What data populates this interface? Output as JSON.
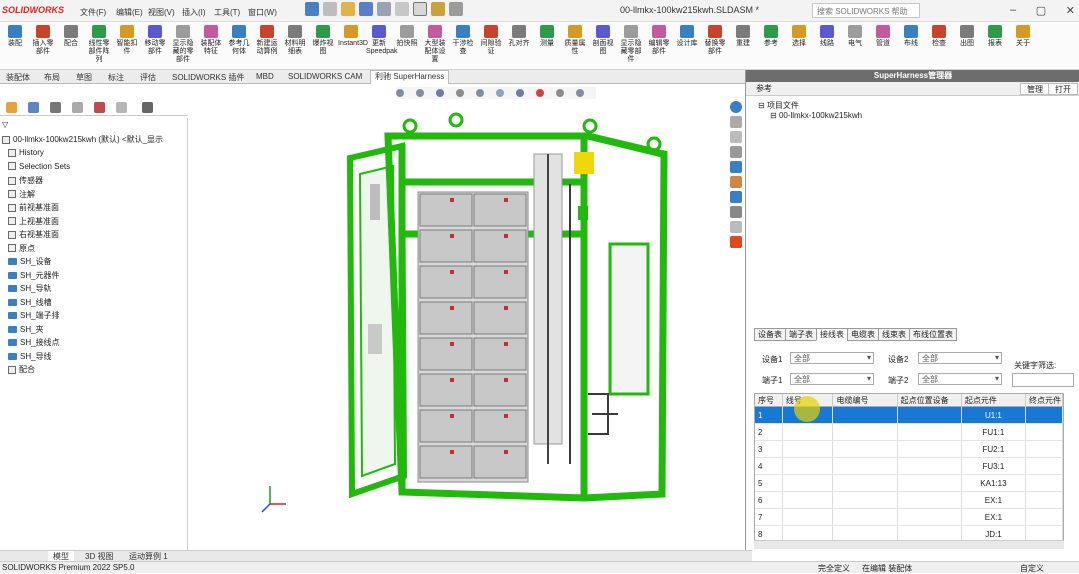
{
  "app": {
    "logo": "SOLIDWORKS",
    "doc_title": "00-llmkx-100kw215kwh.SLDASM *",
    "search_placeholder": "搜索 SOLIDWORKS 帮助",
    "menu": [
      "文件(F)",
      "编辑(E)",
      "视图(V)",
      "插入(I)",
      "工具(T)",
      "窗口(W)"
    ]
  },
  "ribbon": {
    "buttons": [
      "装配",
      "插入零部件",
      "配合",
      "线性零部件阵列",
      "智能扣件",
      "移动零部件",
      "显示隐藏的零部件",
      "装配体特征",
      "参考几何体",
      "新建运动算例",
      "材料明细表",
      "爆炸视图",
      "Instant3D",
      "更新Speedpak",
      "拍快照",
      "大型装配体设置",
      "干涉检查",
      "间隙验证",
      "孔对齐",
      "测量",
      "质量属性",
      "剖面视图",
      "显示隐藏零部件",
      "编辑零部件",
      "设计库",
      "替换零部件",
      "重建",
      "参考",
      "选择",
      "线路",
      "电气",
      "管道",
      "布线",
      "检查",
      "出图",
      "报表",
      "关于"
    ]
  },
  "cmdtabs": [
    "装配体",
    "布局",
    "草图",
    "标注",
    "评估",
    "SOLIDWORKS 插件",
    "MBD",
    "SOLIDWORKS CAM",
    "利驰 SuperHarness"
  ],
  "tree": {
    "root": "00-llmkx-100kw215kwh (默认) <默认_显示",
    "items": [
      "History",
      "Selection Sets",
      "传感器",
      "注解",
      "前视基准面",
      "上视基准面",
      "右视基准面",
      "原点",
      "SH_设备",
      "SH_元器件",
      "SH_导轨",
      "SH_线槽",
      "SH_端子排",
      "SH_夹",
      "SH_接线点",
      "SH_导线",
      "配合"
    ]
  },
  "bottomtabs": [
    "模型",
    "3D 视图",
    "运动算例 1"
  ],
  "status": {
    "product": "SOLIDWORKS Premium 2022 SP5.0",
    "s1": "完全定义",
    "s2": "在编辑 装配体",
    "s3": "自定义"
  },
  "panel": {
    "title": "SuperHarness管理器",
    "toolbar": [
      "参考",
      "管理",
      "打开"
    ],
    "tree": [
      "项目文件",
      "00-llmkx-100kw215kwh"
    ],
    "tabs": [
      "设备表",
      "端子表",
      "接线表",
      "电缆表",
      "线束表",
      "布线位置表"
    ],
    "filters": {
      "l1": "设备1",
      "v1": "全部",
      "l2": "设备2",
      "v2": "全部",
      "l3": "端子1",
      "v3": "全部",
      "l4": "端子2",
      "v4": "全部",
      "l5": "关键字筛选:"
    },
    "columns": [
      "序号",
      "线号",
      "电缆编号",
      "起点位置设备",
      "起点元件",
      "终点元件"
    ],
    "rows": [
      [
        "1",
        "",
        "",
        "",
        "U1:1",
        ""
      ],
      [
        "2",
        "",
        "",
        "",
        "FU1:1",
        ""
      ],
      [
        "3",
        "",
        "",
        "",
        "FU2:1",
        ""
      ],
      [
        "4",
        "",
        "",
        "",
        "FU3:1",
        ""
      ],
      [
        "5",
        "",
        "",
        "",
        "KA1:13",
        ""
      ],
      [
        "6",
        "",
        "",
        "",
        "EX:1",
        ""
      ],
      [
        "7",
        "",
        "",
        "",
        "EX:1",
        ""
      ],
      [
        "8",
        "",
        "",
        "",
        "JD:1",
        ""
      ]
    ]
  },
  "colors": {
    "frame": "#22b80d",
    "accent": "#1779d4"
  }
}
